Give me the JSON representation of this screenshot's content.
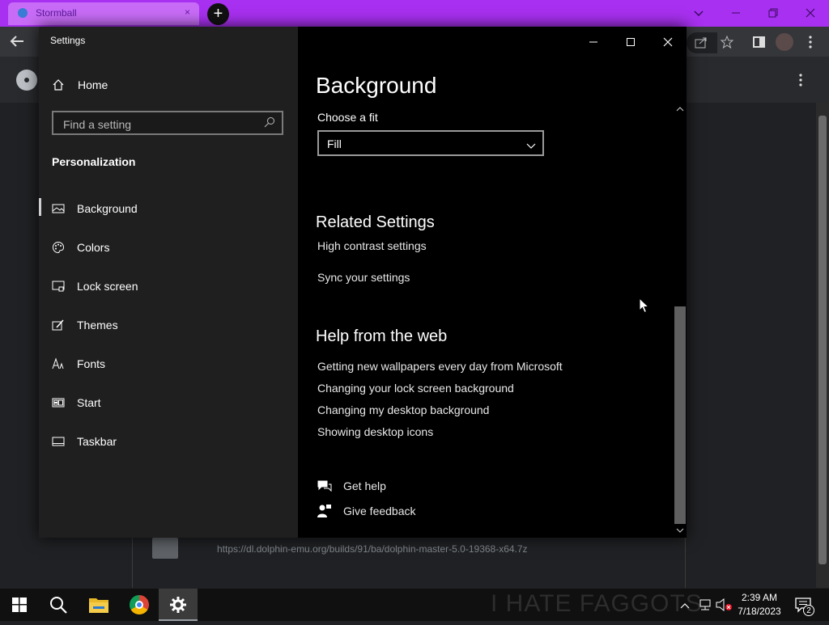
{
  "browser": {
    "tab_title": "Stormball",
    "tab_close": "×",
    "new_tab": "+",
    "page_url": "https://dl.dolphin-emu.org/builds/91/ba/dolphin-master-5.0-19368-x64.7z"
  },
  "settings": {
    "app_title": "Settings",
    "home_label": "Home",
    "search_placeholder": "Find a setting",
    "section_title": "Personalization",
    "nav": [
      {
        "label": "Background",
        "icon": "picture-icon",
        "active": true
      },
      {
        "label": "Colors",
        "icon": "palette-icon",
        "active": false
      },
      {
        "label": "Lock screen",
        "icon": "lock-screen-icon",
        "active": false
      },
      {
        "label": "Themes",
        "icon": "themes-icon",
        "active": false
      },
      {
        "label": "Fonts",
        "icon": "fonts-icon",
        "active": false
      },
      {
        "label": "Start",
        "icon": "start-icon",
        "active": false
      },
      {
        "label": "Taskbar",
        "icon": "taskbar-icon",
        "active": false
      }
    ],
    "page_title": "Background",
    "fit_label": "Choose a fit",
    "fit_value": "Fill",
    "related_title": "Related Settings",
    "related_links": [
      "High contrast settings",
      "Sync your settings"
    ],
    "help_title": "Help from the web",
    "help_links": [
      "Getting new wallpapers every day from Microsoft",
      "Changing your lock screen background",
      "Changing my desktop background",
      "Showing desktop icons"
    ],
    "get_help": "Get help",
    "give_feedback": "Give feedback"
  },
  "taskbar": {
    "time": "2:39 AM",
    "date": "7/18/2023",
    "notification_count": "2",
    "wallpaper_text": "I HATE FAGGOTS"
  },
  "colors": {
    "tabstrip": "#a830f0",
    "settings_left": "#1f1f1f",
    "settings_right": "#000000",
    "taskbar": "#101010"
  }
}
